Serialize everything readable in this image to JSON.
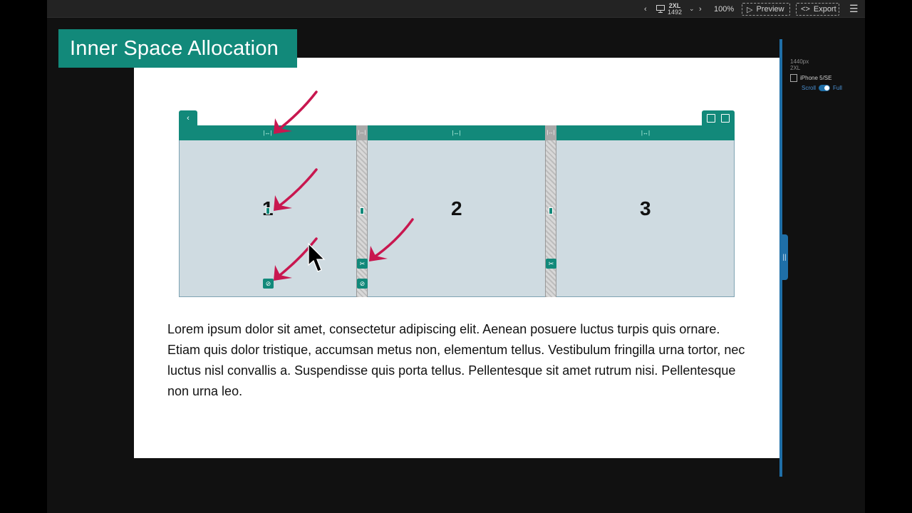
{
  "topbar": {
    "device_size": "2XL",
    "device_width": "1492",
    "zoom": "100%",
    "preview_label": "Preview",
    "export_label": "Export"
  },
  "title_banner": "Inner Space Allocation",
  "right_panel": {
    "width_label": "1440px",
    "size_label": "2XL",
    "device_label": "iPhone 5/SE",
    "scroll_label": "Scroll",
    "full_label": "Full"
  },
  "mock": {
    "columns": [
      {
        "number": "1"
      },
      {
        "number": "2"
      },
      {
        "number": "3"
      }
    ]
  },
  "paragraph": "Lorem ipsum dolor sit amet, consectetur adipiscing elit. Aenean posuere luctus turpis quis ornare. Etiam quis dolor tristique, accumsan metus non, elementum tellus. Vestibulum fringilla urna tortor, nec luctus nisl convallis a. Suspendisse quis porta tellus. Pellentesque sit amet rutrum nisi. Pellentesque non urna leo.",
  "colors": {
    "accent": "#12897a",
    "annotation": "#c8174f",
    "handle": "#1f6fa8"
  }
}
